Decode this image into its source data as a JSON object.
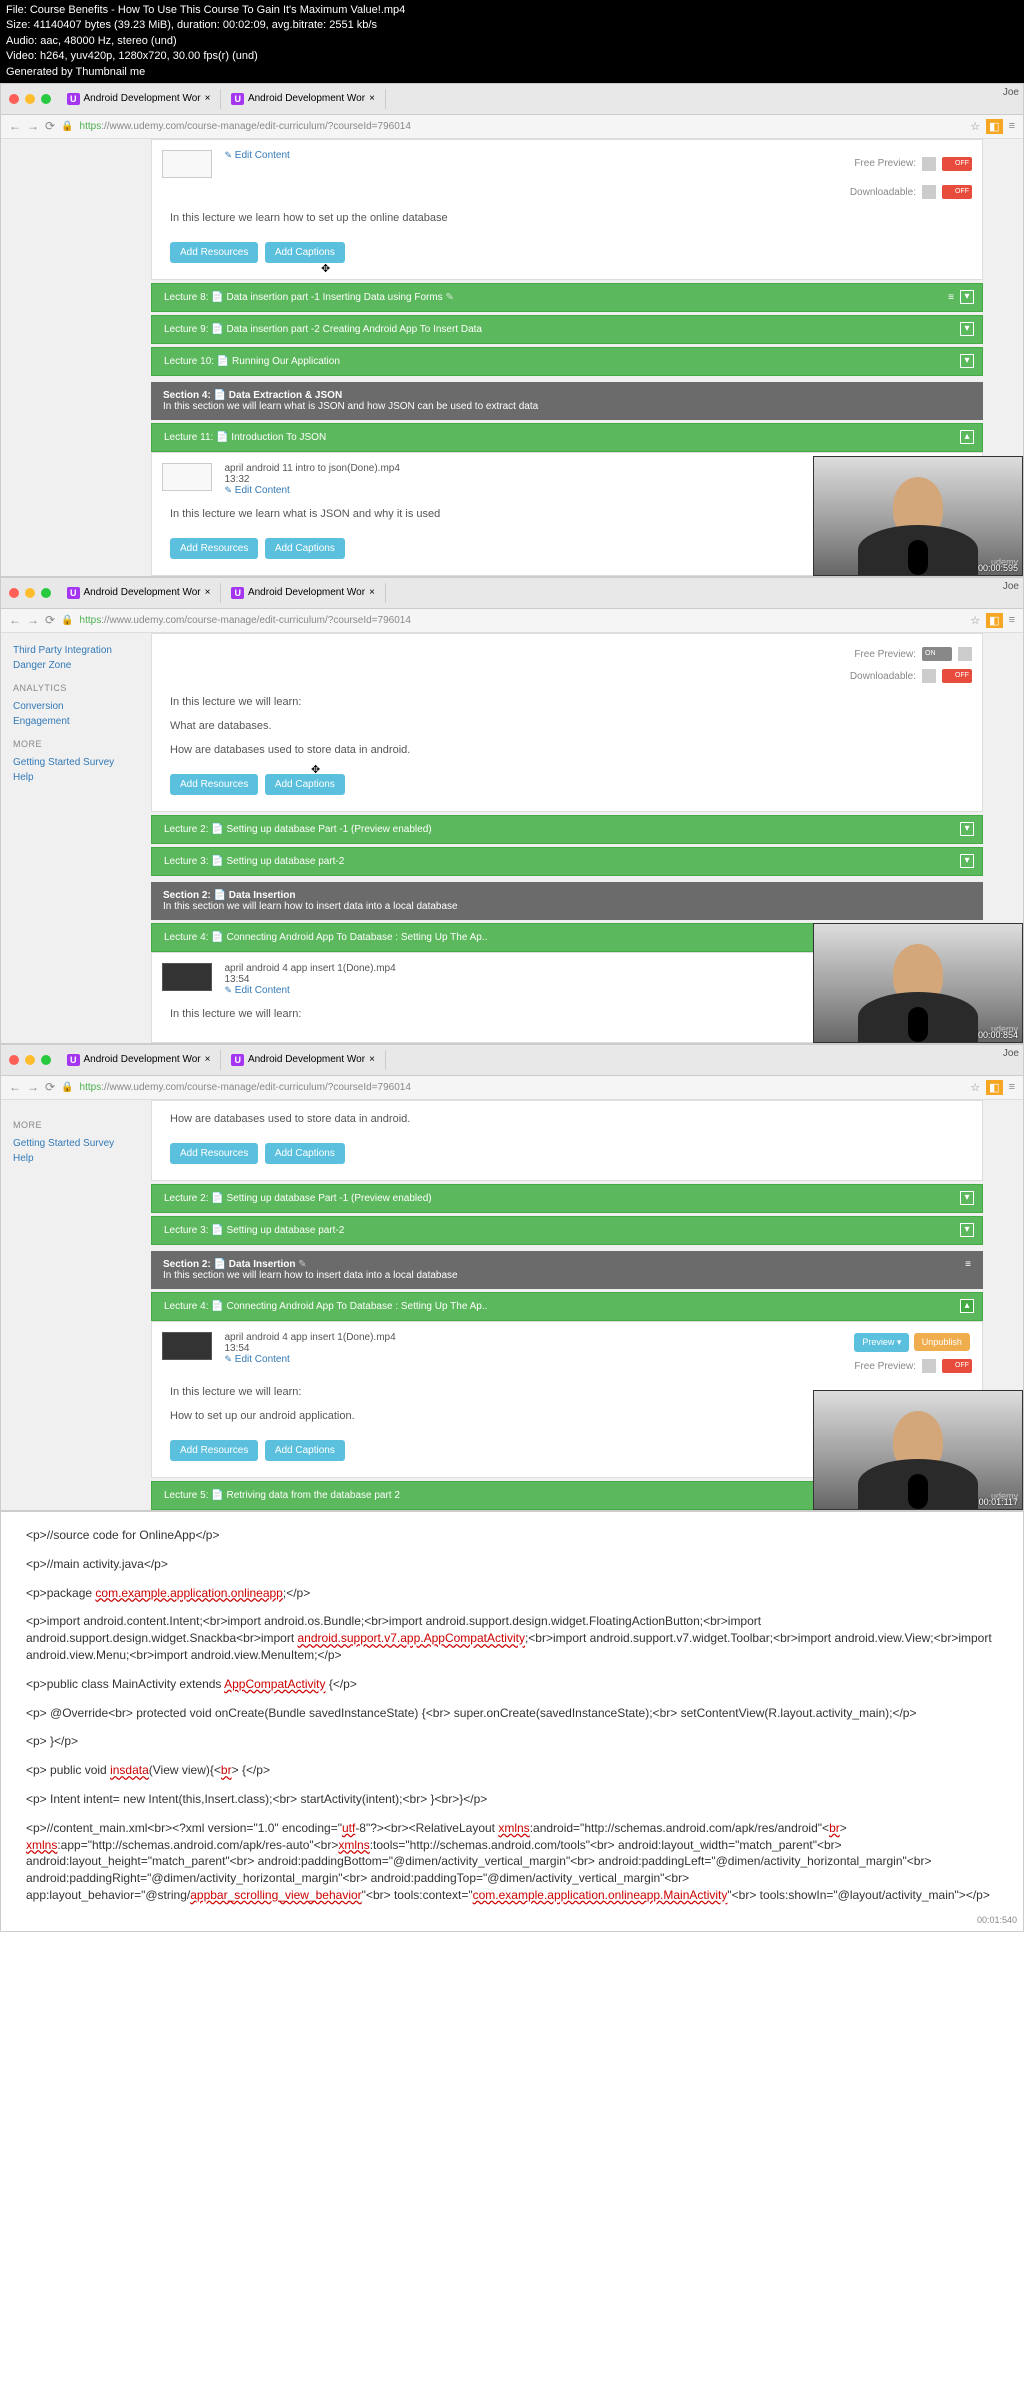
{
  "header": {
    "file": "File: Course Benefits - How To Use This Course To Gain It's Maximum Value!.mp4",
    "size": "Size: 41140407 bytes (39.23 MiB), duration: 00:02:09, avg.bitrate: 2551 kb/s",
    "audio": "Audio: aac, 48000 Hz, stereo (und)",
    "video": "Video: h264, yuv420p, 1280x720, 30.00 fps(r) (und)",
    "gen": "Generated by Thumbnail me"
  },
  "browser": {
    "tab1": "Android Development Wor",
    "tab2": "Android Development Wor",
    "joe": "Joe",
    "url_green": "https",
    "url_rest": "://www.udemy.com/course-manage/edit-curriculum/?courseId=796014"
  },
  "sidebar": {
    "tpi": "Third Party Integration",
    "dz": "Danger Zone",
    "ana": "ANALYTICS",
    "conv": "Conversion",
    "eng": "Engagement",
    "more": "MORE",
    "gss": "Getting Started Survey",
    "help": "Help"
  },
  "f1": {
    "edit": "Edit Content",
    "fp": "Free Preview:",
    "dl": "Downloadable:",
    "off": "OFF",
    "desc": "In this lecture we learn how to set up the online database",
    "ar": "Add Resources",
    "ac": "Add Captions",
    "l8": "Lecture 8: 📄 Data insertion part -1 Inserting Data using Forms",
    "l9": "Lecture 9: 📄 Data insertion part -2 Creating Android App To Insert Data",
    "l10": "Lecture 10: 📄 Running Our Application",
    "s4": "Section 4: 📄 Data Extraction & JSON",
    "s4d": "In this section we will learn what is JSON and how JSON can be used to extract data",
    "l11": "Lecture 11: 📄 Introduction To JSON",
    "vn": "april android 11 intro to json(Done).mp4",
    "vt": "13:32",
    "desc2": "In this lecture we learn what is JSON and why it is used",
    "ts": "00:00:595"
  },
  "f2": {
    "on": "ON",
    "off": "OFF",
    "desc1": "In this lecture we will learn:",
    "desc2": "What are databases.",
    "desc3": "How are databases used to store data in android.",
    "l2": "Lecture 2: 📄 Setting up database Part -1     (Preview enabled)",
    "l3": "Lecture 3: 📄 Setting up database part-2",
    "s2": "Section 2: 📄 Data Insertion",
    "s2d": "In this section we will learn how to insert data into a local database",
    "l4": "Lecture 4: 📄 Connecting Android App To Database : Setting Up The Ap..",
    "vn": "april android 4 app insert 1(Done).mp4",
    "vt": "13:54",
    "ts": "00:00:854"
  },
  "f3": {
    "desc0": "How are databases used to store data in android.",
    "l2": "Lecture 2: 📄 Setting up database Part -1     (Preview enabled)",
    "l3": "Lecture 3: 📄 Setting up database part-2",
    "s2": "Section 2: 📄 Data Insertion",
    "s2d": "In this section we will learn how to insert data into a local database",
    "l4": "Lecture 4: 📄 Connecting Android App To Database : Setting Up The Ap..",
    "vn": "april android 4 app insert 1(Done).mp4",
    "vt": "13:54",
    "pv": "Preview ▾",
    "un": "Unpublish",
    "desc1": "In this lecture we will learn:",
    "desc2": "How to set up our android application.",
    "l5": "Lecture 5: 📄 Retriving data from the database part 2",
    "ts": "00:01:117"
  },
  "code": {
    "l1": "<p>//source code for OnlineApp</p>",
    "l2": "<p>//main activity.java</p>",
    "l3a": "<p>package ",
    "l3b": "com.example.application.onlineapp",
    "l3c": ";</p>",
    "l4": "<p>import android.content.Intent;<br>import android.os.Bundle;<br>import android.support.design.widget.FloatingActionButton;<br>import android.support.design.widget.Snackba",
    "l5a": "<br>import ",
    "l5b": "android.support.v7.app.AppCompatActivity",
    "l5c": ";<br>import android.support.v7.widget.Toolbar;<br>import android.view.View;<br>import android.view.Menu;<br>import android.view.MenuItem;</p>",
    "l6a": "<p>public class MainActivity extends ",
    "l6b": "AppCompatActivity",
    "l6c": " {</p>",
    "l7": "<p>    @Override<br>    protected void onCreate(Bundle savedInstanceState) {<br>        super.onCreate(savedInstanceState);<br>        setContentView(R.layout.activity_main);</p>",
    "l8": "<p>    }</p>",
    "l9a": "<p>    public void ",
    "l9b": "insdata",
    "l9c": "(View view){",
    "l9d": "br",
    "l9e": "    {</p>",
    "l10": "<p>        Intent intent= new Intent(this,Insert.class);<br>        startActivity(intent);<br>    }<br>}</p>",
    "l11a": "<p>//content_main.xml<br><?xml version=\"1.0\" encoding=\"",
    "l11b": "utf",
    "l11c": "-8\"?><br><RelativeLayout ",
    "l11d": "xmlns",
    "l11e": ":android=\"http://schemas.android.com/apk/res/android\"",
    "l11f": "br",
    "l12a": "xmlns",
    "l12b": ":app=\"http://schemas.android.com/apk/res-auto\"<br>",
    "l13a": "xmlns",
    "l13b": ":tools=\"http://schemas.android.com/tools\"<br>    android:layout_width=\"match_parent\"<br> android:layout_height=\"match_parent\"<br>    android:paddingBottom=\"@dimen/activity_vertical_margin\"<br>    android:paddingLeft=\"@dimen/activity_horizontal_margin\"<br> android:paddingRight=\"@dimen/activity_horizontal_margin\"<br> android:paddingTop=\"@dimen/activity_vertical_margin\"<br> app:layout_behavior=\"@string/",
    "l13c": "appbar_scrolling_view_behavior",
    "l13d": "\"<br> tools:context=\"",
    "l13e": "com.example.application.onlineapp.MainActivity",
    "l13f": "\"<br> tools:showIn=\"@layout/activity_main\"></p>",
    "ts": "00:01:540"
  }
}
